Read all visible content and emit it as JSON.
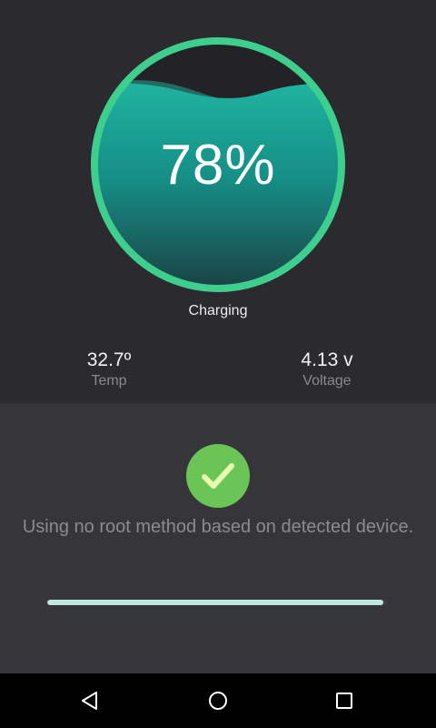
{
  "battery": {
    "percent_label": "78%",
    "level": 0.78,
    "status": "Charging"
  },
  "stats": {
    "temp": {
      "value": "32.7º",
      "label": "Temp"
    },
    "voltage": {
      "value": "4.13 v",
      "label": "Voltage"
    }
  },
  "method": {
    "message": "Using no root method based on detected device.",
    "progress": 0.99
  },
  "icons": {
    "check": "check-icon",
    "back": "back-icon",
    "home": "home-icon",
    "recents": "recents-icon"
  },
  "colors": {
    "ring": "#3ecf8e",
    "water_top": "#1d9e8e",
    "water_bottom": "#1a4a4a",
    "check_bg": "#6bc456",
    "check_mark": "#e9ffb0",
    "progress": "#bfe8e2"
  }
}
